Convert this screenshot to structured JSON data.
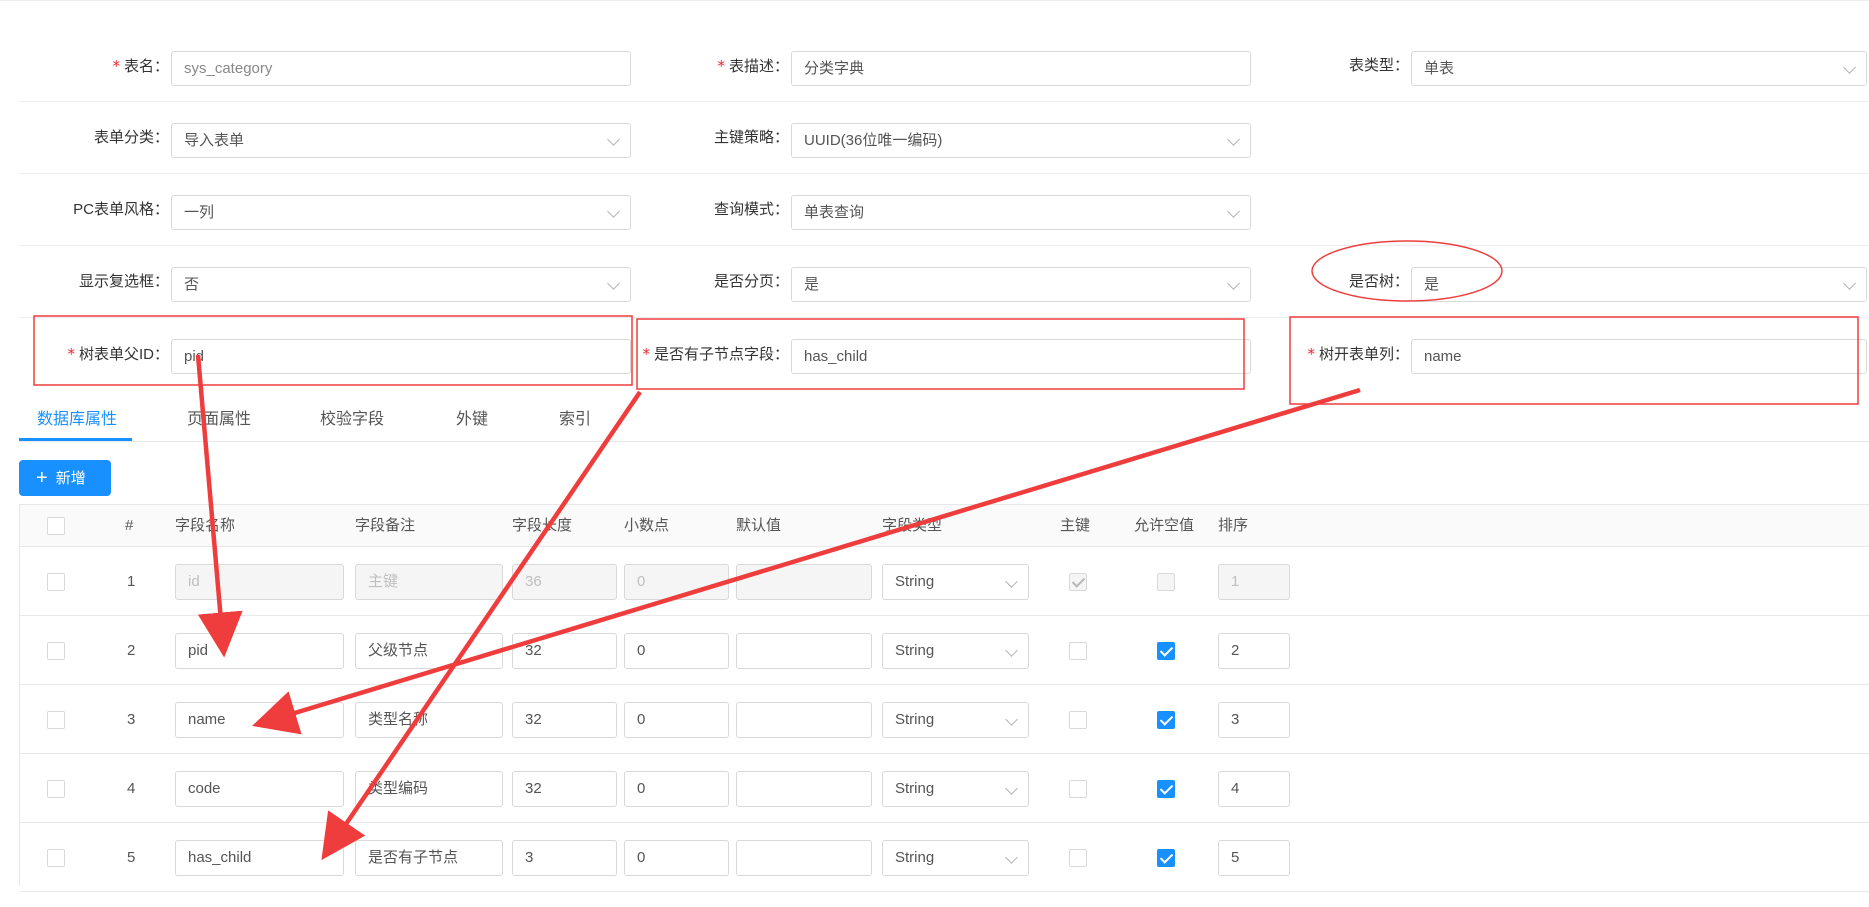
{
  "form": {
    "table_name": {
      "label": "表名",
      "required": true,
      "value": "sys_category"
    },
    "table_desc": {
      "label": "表描述",
      "required": true,
      "value": "分类字典"
    },
    "table_type": {
      "label": "表类型",
      "value": "单表"
    },
    "form_category": {
      "label": "表单分类",
      "value": "导入表单"
    },
    "pk_strategy": {
      "label": "主键策略",
      "value": "UUID(36位唯一编码)"
    },
    "pc_form_style": {
      "label": "PC表单风格",
      "value": "一列"
    },
    "query_mode": {
      "label": "查询模式",
      "value": "单表查询"
    },
    "show_checkbox": {
      "label": "显示复选框",
      "value": "否"
    },
    "paginate": {
      "label": "是否分页",
      "value": "是"
    },
    "is_tree": {
      "label": "是否树",
      "value": "是"
    },
    "tree_parent_id": {
      "label": "树表单父ID",
      "required": true,
      "value": "pid"
    },
    "has_child_field": {
      "label": "是否有子节点字段",
      "required": true,
      "value": "has_child"
    },
    "tree_text_col": {
      "label": "树开表单列",
      "required": true,
      "value": "name"
    },
    "colon": "："
  },
  "tabs": [
    "数据库属性",
    "页面属性",
    "校验字段",
    "外键",
    "索引"
  ],
  "active_tab": "数据库属性",
  "add_button": {
    "icon": "+",
    "label": "新增"
  },
  "table": {
    "headers": {
      "index": "#",
      "field_name": "字段名称",
      "field_remark": "字段备注",
      "field_length": "字段长度",
      "decimal": "小数点",
      "default_value": "默认值",
      "field_type": "字段类型",
      "primary_key": "主键",
      "nullable": "允许空值",
      "order": "排序"
    },
    "rows": [
      {
        "index": "1",
        "name": "id",
        "remark": "主键",
        "length": "36",
        "decimal": "0",
        "default": "",
        "type": "String",
        "pk": true,
        "nullable": false,
        "order": "1",
        "disabled": true
      },
      {
        "index": "2",
        "name": "pid",
        "remark": "父级节点",
        "length": "32",
        "decimal": "0",
        "default": "",
        "type": "String",
        "pk": false,
        "nullable": true,
        "order": "2",
        "disabled": false
      },
      {
        "index": "3",
        "name": "name",
        "remark": "类型名称",
        "length": "32",
        "decimal": "0",
        "default": "",
        "type": "String",
        "pk": false,
        "nullable": true,
        "order": "3",
        "disabled": false
      },
      {
        "index": "4",
        "name": "code",
        "remark": "类型编码",
        "length": "32",
        "decimal": "0",
        "default": "",
        "type": "String",
        "pk": false,
        "nullable": true,
        "order": "4",
        "disabled": false
      },
      {
        "index": "5",
        "name": "has_child",
        "remark": "是否有子节点",
        "length": "3",
        "decimal": "0",
        "default": "",
        "type": "String",
        "pk": false,
        "nullable": true,
        "order": "5",
        "disabled": false
      }
    ]
  },
  "colors": {
    "primary": "#1890ff",
    "annotation_red": "#ef3d3d",
    "required_star": "#f5222d"
  }
}
